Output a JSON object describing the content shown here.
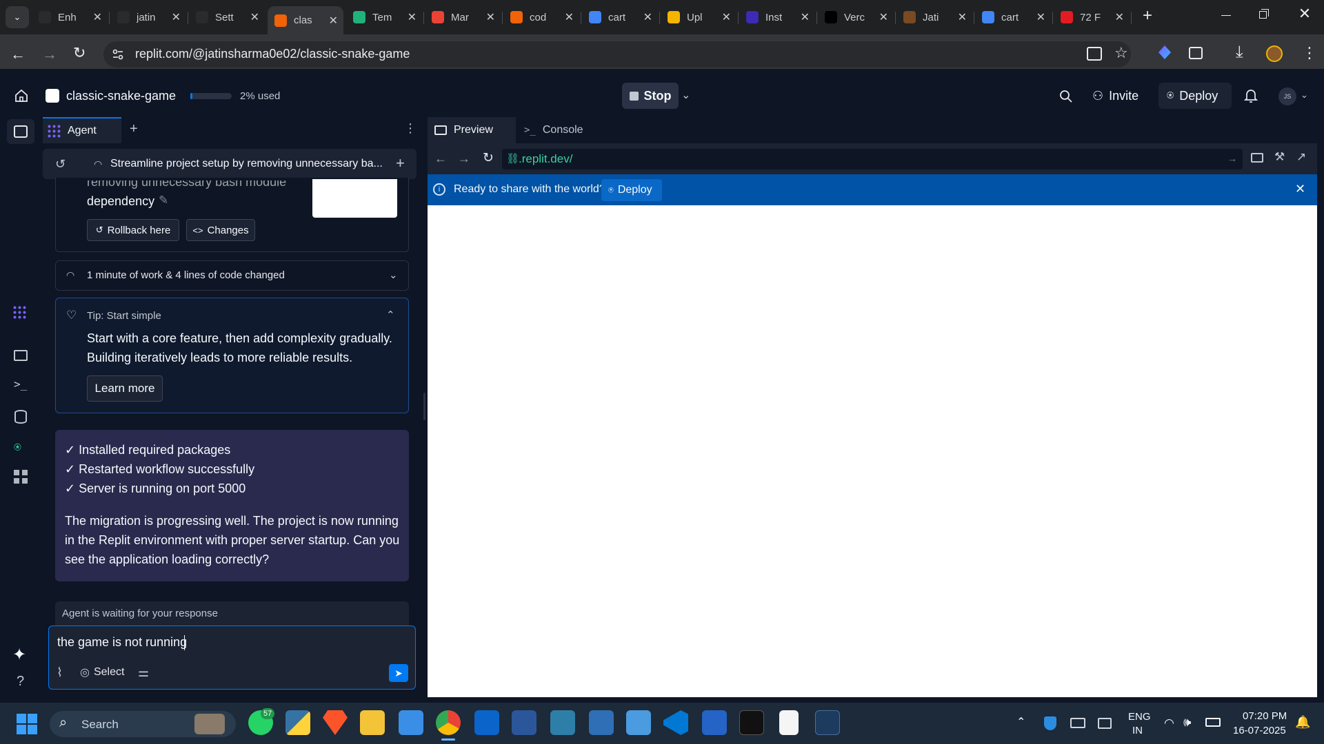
{
  "browser": {
    "tabs": [
      {
        "title": "Enh",
        "icon": "openai-icon",
        "color": "#2b2b2b"
      },
      {
        "title": "jatin",
        "icon": "github-icon",
        "color": "#2b2b2b"
      },
      {
        "title": "Sett",
        "icon": "gear-icon",
        "color": "#2b2b2b"
      },
      {
        "title": "clas",
        "icon": "replit-icon",
        "color": "#f26207"
      },
      {
        "title": "Tem",
        "icon": "template-icon",
        "color": "#20b27a"
      },
      {
        "title": "Mar",
        "icon": "gmail-icon",
        "color": "#ea4335"
      },
      {
        "title": "cod",
        "icon": "code-icon",
        "color": "#f26207"
      },
      {
        "title": "cart",
        "icon": "google-icon",
        "color": "#4285f4"
      },
      {
        "title": "Upl",
        "icon": "upload-icon",
        "color": "#f4b400"
      },
      {
        "title": "Inst",
        "icon": "p-icon",
        "color": "#3b2bb5"
      },
      {
        "title": "Verc",
        "icon": "vercel-icon",
        "color": "#000000"
      },
      {
        "title": "Jati",
        "icon": "avatar-icon",
        "color": "#7a4a22"
      },
      {
        "title": "cart",
        "icon": "google-icon",
        "color": "#4285f4"
      },
      {
        "title": "72 F",
        "icon": "f-icon",
        "color": "#e31b23"
      }
    ],
    "url": "replit.com/@jatinsharma0e02/classic-snake-game"
  },
  "replit": {
    "project_name": "classic-snake-game",
    "usage_text": "2% used",
    "stop_label": "Stop",
    "invite_label": "Invite",
    "deploy_label": "Deploy",
    "avatar_initials": "JS"
  },
  "agent": {
    "tab_label": "Agent",
    "checkpoint_title": "Streamline project setup by removing unnecessary ba...",
    "checkpoint_line1": "removing unnecessary bash module",
    "checkpoint_line2": "dependency",
    "rollback_label": "Rollback here",
    "changes_label": "Changes",
    "work_summary": "1 minute of work & 4 lines of code changed",
    "tip_title": "Tip: Start simple",
    "tip_body_1": "Start with a core feature, then add complexity gradually.",
    "tip_body_2": "Building iteratively leads to more reliable results.",
    "learn_more_label": "Learn more",
    "checks": [
      "✓ Installed required packages",
      "✓ Restarted workflow successfully",
      "✓ Server is running on port 5000"
    ],
    "message_1": "The migration is progressing well. The project is now running",
    "message_2": "in the Replit environment with proper server startup. Can you",
    "message_3": "see the application loading correctly?",
    "waiting_text": "Agent is waiting for your response",
    "input_value": "the game is not running",
    "select_label": "Select"
  },
  "preview": {
    "tab_preview": "Preview",
    "tab_console": "Console",
    "url": ".replit.dev/",
    "banner_text": "Ready to share with the world?",
    "banner_deploy": "Deploy"
  },
  "taskbar": {
    "search_label": "Search",
    "whatsapp_badge": "57",
    "lang_line1": "ENG",
    "lang_line2": "IN",
    "time": "07:20 PM",
    "date": "16-07-2025"
  }
}
